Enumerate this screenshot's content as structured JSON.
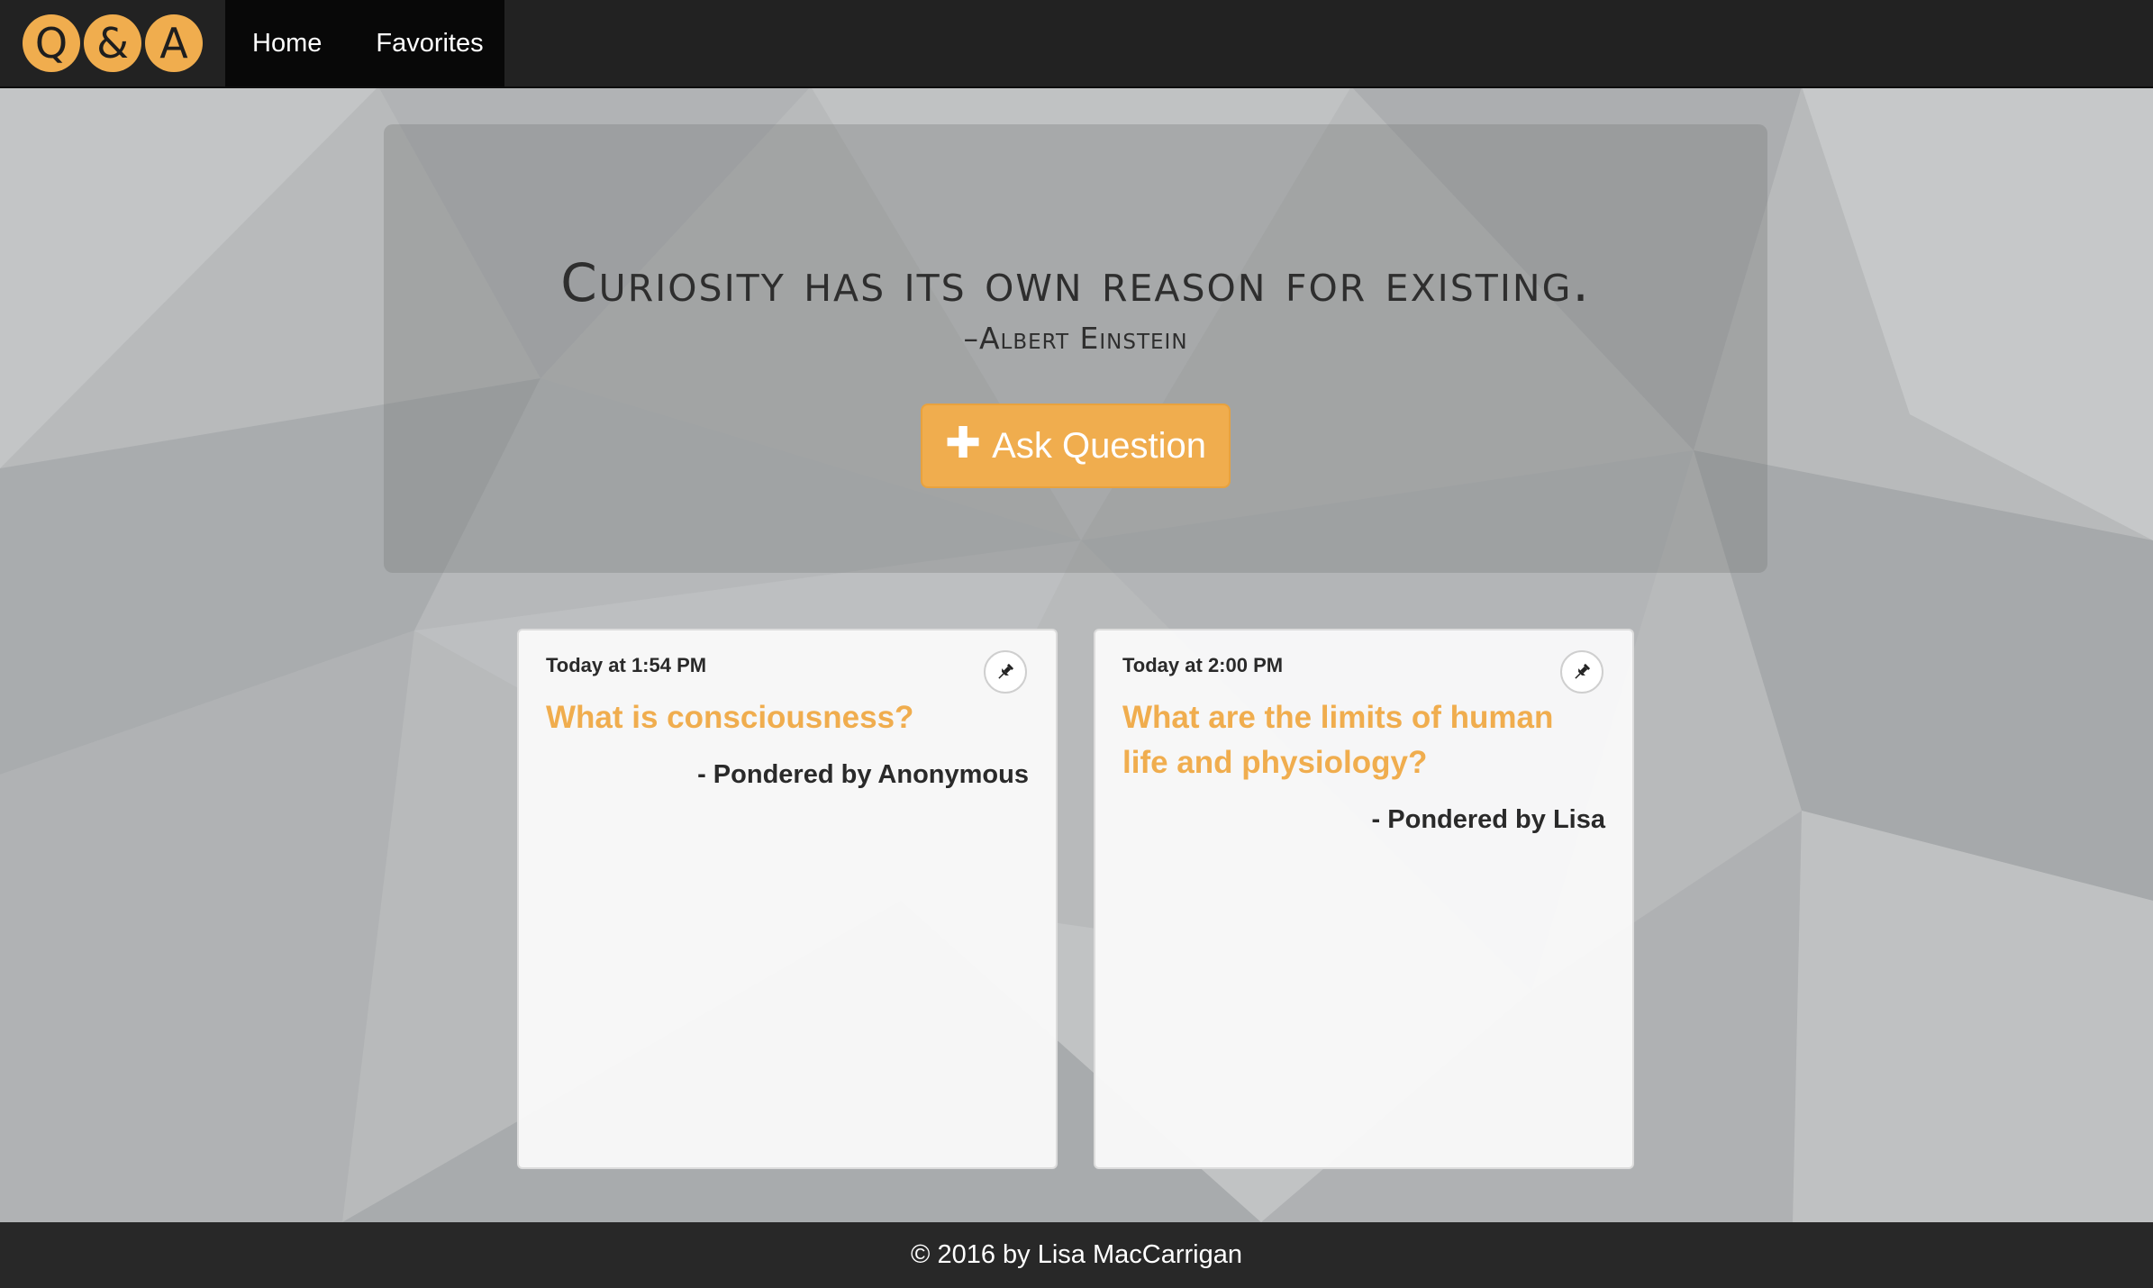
{
  "brand": {
    "letters": [
      "Q",
      "&",
      "A"
    ],
    "accent_color": "#f0ad4e"
  },
  "nav": {
    "home_label": "Home",
    "favorites_label": "Favorites"
  },
  "hero": {
    "quote": "Curiosity has its own reason for existing.",
    "author": "–Albert Einstein",
    "ask_button_label": "Ask Question",
    "ask_button_icon": "plus-icon"
  },
  "questions": [
    {
      "timestamp": "Today at 1:54 PM",
      "question": "What is consciousness?",
      "author": "- Pondered by Anonymous",
      "pin_icon": "pushpin-icon"
    },
    {
      "timestamp": "Today at 2:00 PM",
      "question": "What are the limits of human life and physiology?",
      "author": "- Pondered by Lisa",
      "pin_icon": "pushpin-icon"
    }
  ],
  "footer": {
    "text": "© 2016 by Lisa MacCarrigan"
  }
}
